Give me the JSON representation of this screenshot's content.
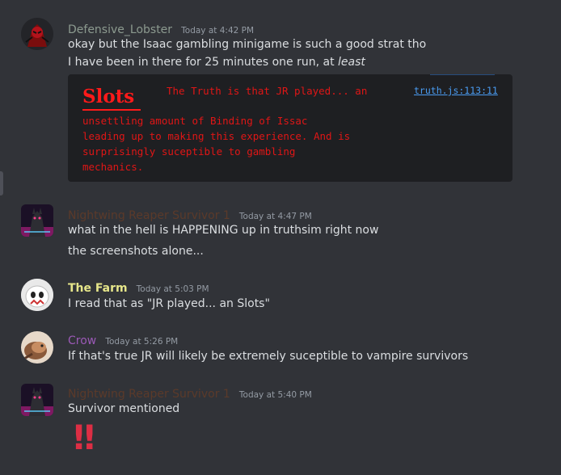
{
  "messages": [
    {
      "author": "Defensive_Lobster",
      "author_color": "#8c9a8f",
      "timestamp": "Today at 4:42 PM",
      "lines": [
        "okay but the Isaac gambling minigame is such a good strat tho"
      ],
      "line2_prefix": "I have been in there for 25 minutes one run, at ",
      "line2_emphasis": "least"
    },
    {
      "author": "Nightwing Reaper Survivor 1",
      "author_color": "#5b3a2a",
      "timestamp": "Today at 4:47 PM",
      "lines": [
        "what in the hell is HAPPENING up in truthsim right now",
        "the screenshots alone..."
      ]
    },
    {
      "author": "The Farm",
      "author_color": "#e6e68a",
      "timestamp": "Today at 5:03 PM",
      "lines": [
        "I read that as \"JR played... an Slots\""
      ]
    },
    {
      "author": "Crow",
      "author_color": "#9b59b6",
      "timestamp": "Today at 5:26 PM",
      "lines": [
        "If that's true JR will likely be extremely suceptible to vampire survivors"
      ]
    },
    {
      "author": "Nightwing Reaper Survivor 1",
      "author_color": "#5b3a2a",
      "timestamp": "Today at 5:40 PM",
      "lines": [
        "Survivor mentioned"
      ],
      "reaction_emoji": "‼"
    }
  ],
  "embed": {
    "heading": "Slots",
    "top_text": "The Truth is that JR played... an",
    "link": "truth.js:113:11",
    "body_lines": [
      "unsettling amount of Binding of Issac",
      "leading up to making this experience. And is",
      "surprisingly suceptible to gambling",
      "mechanics."
    ],
    "text_color": "#e01616"
  }
}
